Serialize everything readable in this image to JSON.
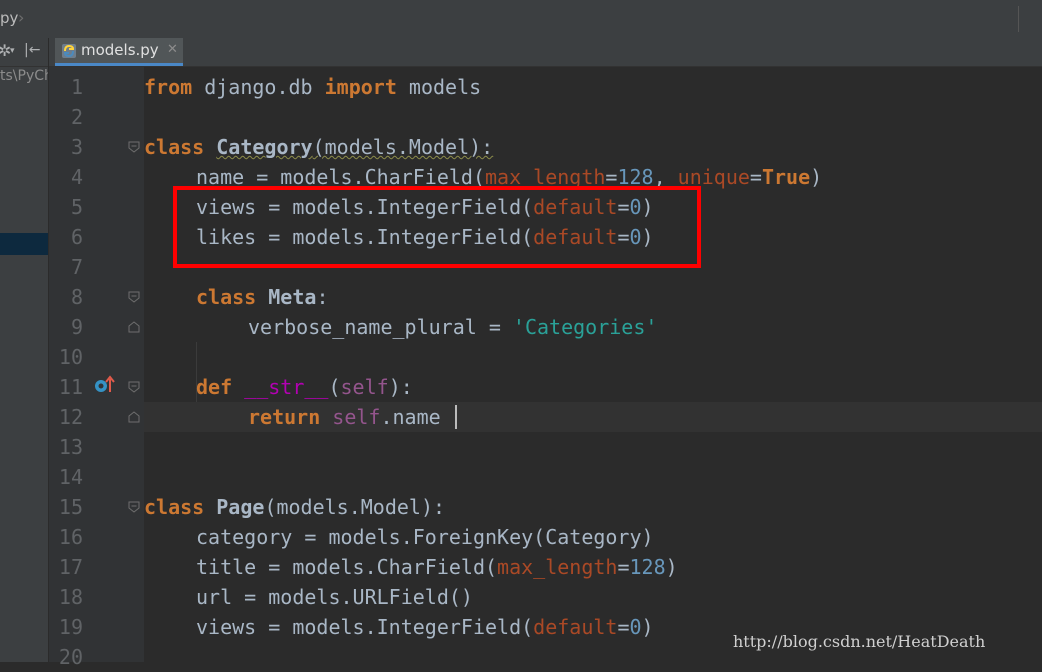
{
  "breadcrumb": {
    "file_partial": "py"
  },
  "project_panel": {
    "path_partial": "ts\\PyCh"
  },
  "tab": {
    "label": "models.py",
    "close_icon": "close-icon",
    "file_icon": "python-file-icon"
  },
  "gutter": {
    "line_numbers": [
      "1",
      "2",
      "3",
      "4",
      "5",
      "6",
      "7",
      "8",
      "9",
      "10",
      "11",
      "12",
      "13",
      "14",
      "15",
      "16",
      "17",
      "18",
      "19",
      "20"
    ]
  },
  "code": {
    "l1": {
      "kw1": "from",
      "t1": " django.db ",
      "kw2": "import",
      "t2": " models"
    },
    "l3": {
      "kw": "class",
      "name": "Category",
      "base": "(models.Model):"
    },
    "l4": {
      "t1": "name = models.CharField(",
      "p1": "max_length",
      "eq1": "=",
      "n1": "128",
      "c1": ", ",
      "p2": "unique",
      "eq2": "=",
      "kw": "True",
      "end": ")"
    },
    "l5": {
      "t1": "views = models.IntegerField(",
      "p1": "default",
      "eq": "=",
      "n1": "0",
      "end": ")"
    },
    "l6": {
      "t1": "likes = models.IntegerField(",
      "p1": "default",
      "eq": "=",
      "n1": "0",
      "end": ")"
    },
    "l8": {
      "kw": "class",
      "name": "Meta",
      "end": ":"
    },
    "l9": {
      "t1": "verbose_name_plural = ",
      "s1": "'Categories'"
    },
    "l11": {
      "kw": "def",
      "sp": " ",
      "fn": "__str__",
      "open": "(",
      "self": "self",
      "close": "):"
    },
    "l12": {
      "kw": "return",
      "sp": " ",
      "self": "self",
      "t1": ".name"
    },
    "l15": {
      "kw": "class",
      "name": "Page",
      "base": "(models.Model):"
    },
    "l16": {
      "t1": "category = models.ForeignKey(Category)"
    },
    "l17": {
      "t1": "title = models.CharField(",
      "p1": "max_length",
      "eq": "=",
      "n1": "128",
      "end": ")"
    },
    "l18": {
      "t1": "url = models.URLField()"
    },
    "l19": {
      "t1": "views = models.IntegerField(",
      "p1": "default",
      "eq": "=",
      "n1": "0",
      "end": ")"
    }
  },
  "watermark": "http://blog.csdn.net/HeatDeath",
  "colors": {
    "keyword": "#cc7832",
    "param": "#aa4926",
    "number": "#6897bb",
    "string": "#6a8759",
    "self": "#94558d",
    "magic": "#b200b2",
    "highlight": "#ff0000",
    "background": "#2b2b2b"
  }
}
